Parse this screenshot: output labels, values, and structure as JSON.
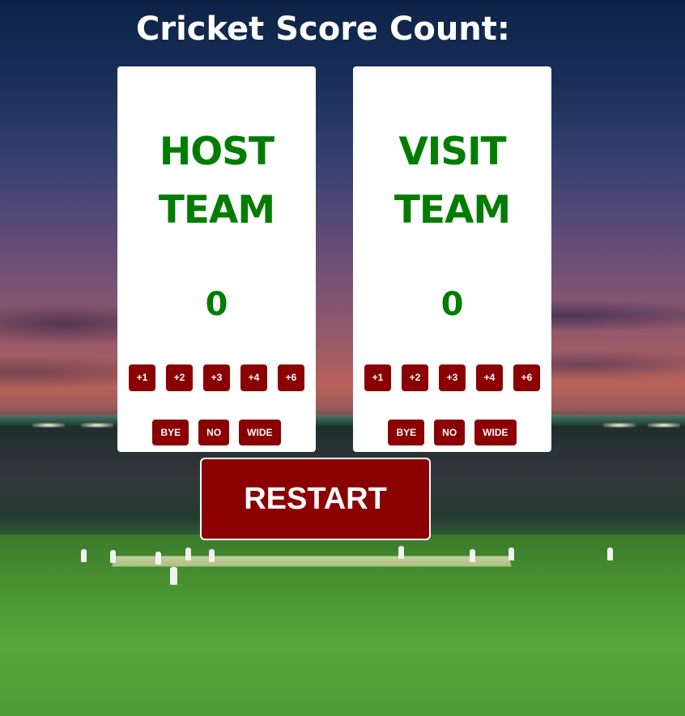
{
  "title": "Cricket Score Count:",
  "teams": [
    {
      "name_line1": "HOST",
      "name_line2": "TEAM",
      "score": "0",
      "run_buttons": [
        "+1",
        "+2",
        "+3",
        "+4",
        "+6"
      ],
      "extra_buttons": [
        "BYE",
        "NO",
        "WIDE"
      ]
    },
    {
      "name_line1": "VISIT",
      "name_line2": "TEAM",
      "score": "0",
      "run_buttons": [
        "+1",
        "+2",
        "+3",
        "+4",
        "+6"
      ],
      "extra_buttons": [
        "BYE",
        "NO",
        "WIDE"
      ]
    }
  ],
  "restart_label": "RESTART",
  "colors": {
    "team_text": "#007d00",
    "button_bg": "#8b0000",
    "button_text": "#ffffff",
    "card_bg": "#ffffff",
    "title_text": "#ffffff"
  }
}
